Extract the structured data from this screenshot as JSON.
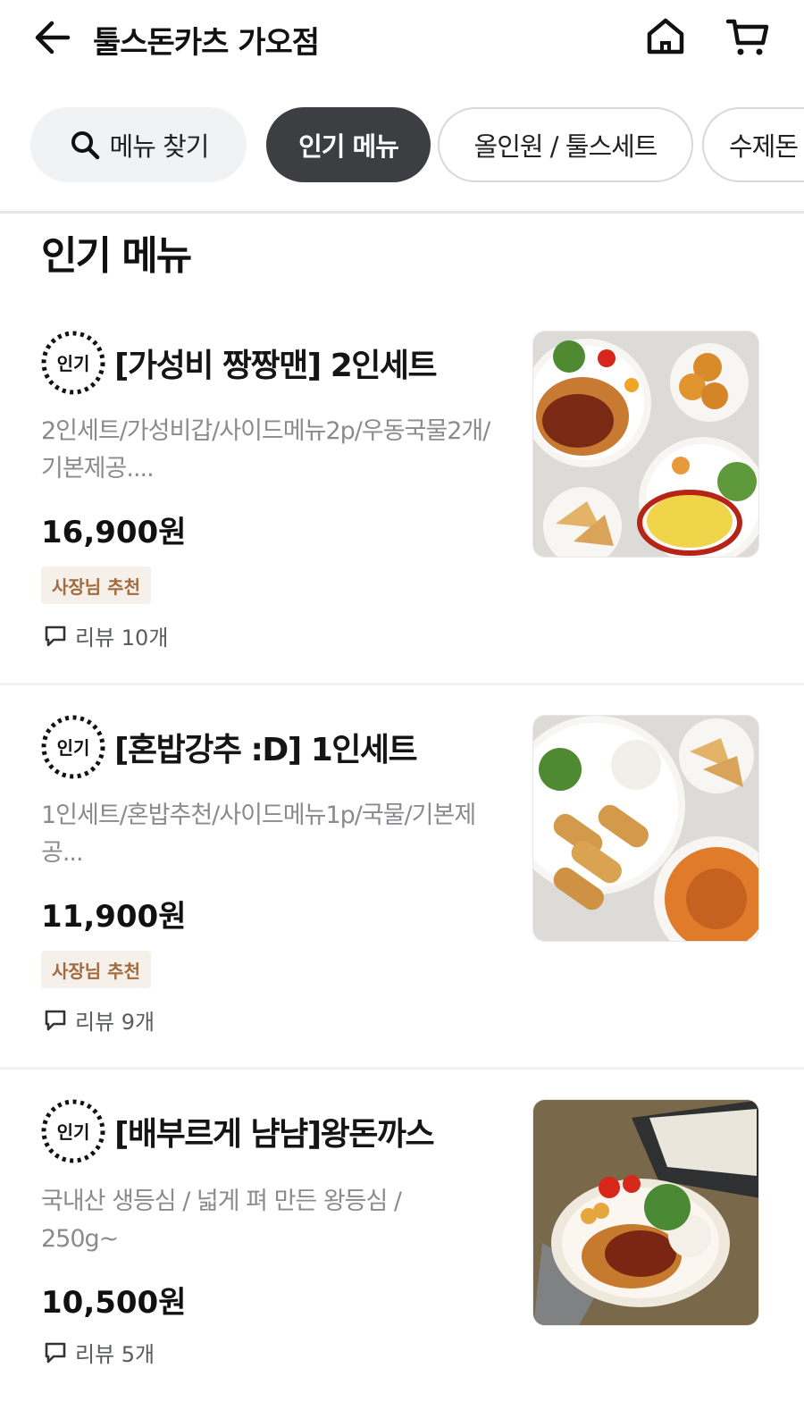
{
  "header": {
    "title": "툴스돈카츠 가오점",
    "back_icon": "arrow-left-icon",
    "home_icon": "home-icon",
    "cart_icon": "cart-icon"
  },
  "tabs": {
    "search_label": "메뉴 찾기",
    "items": [
      {
        "label": "인기 메뉴",
        "active": true
      },
      {
        "label": "올인원 / 툴스세트",
        "active": false
      },
      {
        "label": "수제돈",
        "active": false
      }
    ]
  },
  "section": {
    "title": "인기 메뉴"
  },
  "menu_items": [
    {
      "badge": "인기",
      "name": "[가성비 짱짱맨] 2인세트",
      "desc": "2인세트/가성비갑/사이드메뉴2p/우동국물2개/기본제공....",
      "price": "16,900원",
      "tag": "사장님 추천",
      "review": "리뷰 10개"
    },
    {
      "badge": "인기",
      "name": "[혼밥강추 :D] 1인세트",
      "desc": "1인세트/혼밥추천/사이드메뉴1p/국물/기본제공...",
      "price": "11,900원",
      "tag": "사장님 추천",
      "review": "리뷰 9개"
    },
    {
      "badge": "인기",
      "name": "[배부르게 냠냠]왕돈까스",
      "desc": "국내산 생등심 / 넓게 펴 만든 왕등심 / 250g~",
      "price": "10,500원",
      "review": "리뷰 5개"
    }
  ],
  "colors": {
    "active_chip": "#3d3e41",
    "tag_bg": "#f6f0ea",
    "tag_text": "#a36a3d"
  }
}
